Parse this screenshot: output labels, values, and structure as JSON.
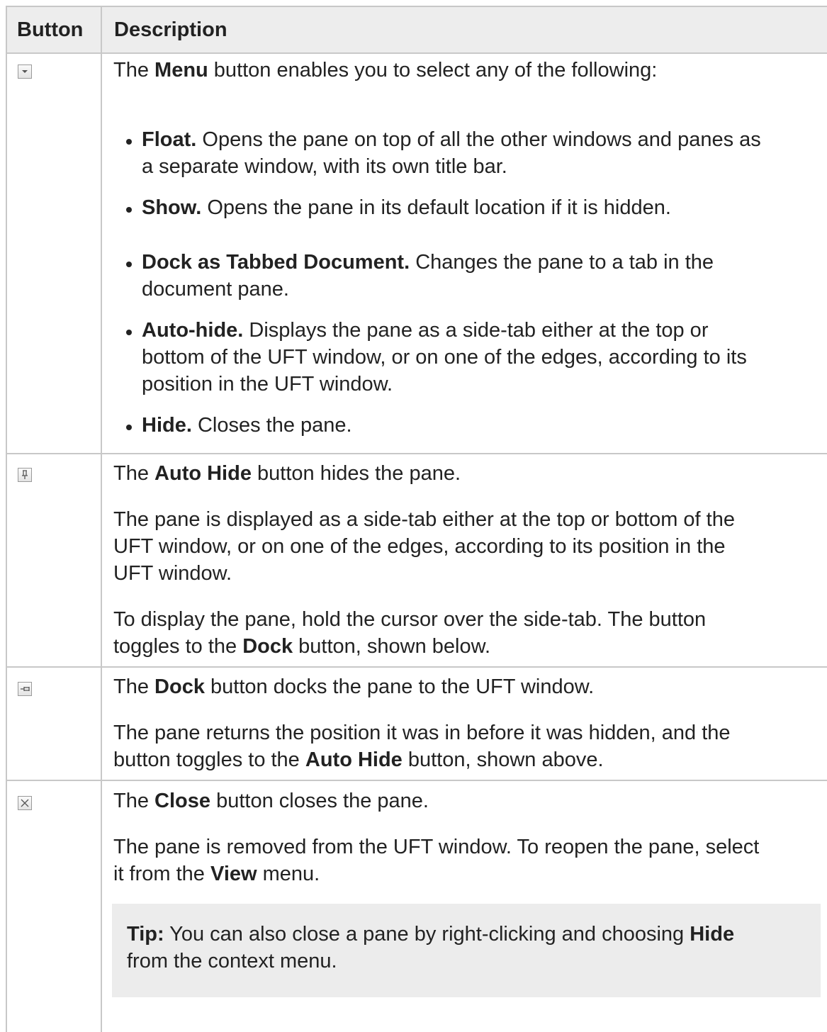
{
  "table": {
    "headers": {
      "button": "Button",
      "description": "Description"
    },
    "rows": [
      {
        "icon": "menu-dropdown-icon",
        "intro": {
          "pre": "The ",
          "bold": "Menu",
          "post": " button enables you to select any of the following:"
        },
        "items": [
          {
            "bold": "Float.",
            "lines": [
              " Opens the pane on top of all the other windows and panes as",
              "a separate window, with its own title bar."
            ]
          },
          {
            "bold": "Show.",
            "lines": [
              " Opens the pane in its default location if it is hidden."
            ]
          },
          {
            "bold": "Dock as Tabbed Document.",
            "lines": [
              " Changes the pane to a tab in the",
              "document pane."
            ]
          },
          {
            "bold": "Auto-hide.",
            "lines": [
              " Displays the pane as a side-tab either at the top or",
              "bottom of the UFT window, or on one of the edges, according to its",
              "position in the UFT window."
            ]
          },
          {
            "bold": "Hide.",
            "lines": [
              " Closes the pane."
            ]
          }
        ]
      },
      {
        "icon": "pin-icon",
        "intro": {
          "pre": "The ",
          "bold": "Auto Hide",
          "post": " button hides the pane."
        },
        "para2": [
          "The pane is displayed as a side-tab either at the top or bottom of the",
          "UFT window, or on one of the edges, according to its position in the",
          "UFT window."
        ],
        "para3": {
          "line1": "To display the pane, hold the cursor over the side-tab. The button",
          "pre": "toggles to the ",
          "bold": "Dock",
          "post": " button, shown below."
        }
      },
      {
        "icon": "dock-pin-icon",
        "intro": {
          "pre": "The ",
          "bold": "Dock",
          "post": " button docks the pane to the UFT window."
        },
        "para2": {
          "line1": "The pane returns the position it was in before it was hidden, and the",
          "pre": "button toggles to the ",
          "bold": "Auto Hide",
          "post": " button, shown above."
        }
      },
      {
        "icon": "close-icon",
        "intro": {
          "pre": "The ",
          "bold": "Close",
          "post": " button closes the pane."
        },
        "para2": {
          "line1": "The pane is removed from the UFT window. To reopen the pane, select",
          "pre": "it from the ",
          "bold": "View",
          "post": " menu."
        },
        "tip": {
          "label": "Tip:",
          "pre": " You can also close a pane by right-clicking and choosing ",
          "bold": "Hide",
          "line2": "from the context menu."
        }
      }
    ]
  }
}
